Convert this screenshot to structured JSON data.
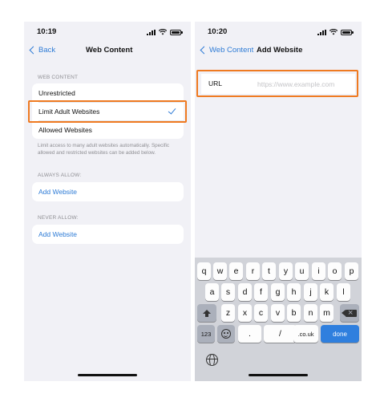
{
  "left": {
    "time": "10:19",
    "back_label": "Back",
    "title": "Web Content",
    "section_web_content": "WEB CONTENT",
    "options": [
      {
        "label": "Unrestricted"
      },
      {
        "label": "Limit Adult Websites",
        "selected": true
      },
      {
        "label": "Allowed Websites"
      }
    ],
    "footnote": "Limit access to many adult websites automatically. Specific allowed and restricted websites can be added below.",
    "section_always_allow": "ALWAYS ALLOW:",
    "always_allow_add": "Add Website",
    "section_never_allow": "NEVER ALLOW:",
    "never_allow_add": "Add Website"
  },
  "right": {
    "time": "10:20",
    "back_label": "Web Content",
    "title": "Add Website",
    "url_label": "URL",
    "url_value": "",
    "url_placeholder": "https://www.example.com",
    "keyboard": {
      "row1": [
        "q",
        "w",
        "e",
        "r",
        "t",
        "y",
        "u",
        "i",
        "o",
        "p"
      ],
      "row2": [
        "a",
        "s",
        "d",
        "f",
        "g",
        "h",
        "j",
        "k",
        "l"
      ],
      "row3": [
        "z",
        "x",
        "c",
        "v",
        "b",
        "n",
        "m"
      ],
      "numbers_key": "123",
      "dot_key": ".",
      "slash_key": "/",
      "dotcom_key": ".co.uk",
      "done_key": "done"
    }
  },
  "colors": {
    "accent": "#2f7cd6",
    "highlight": "#ef7a21",
    "background": "#f1f1f6"
  },
  "icons": [
    "chevron-left-icon",
    "checkmark-icon",
    "shift-icon",
    "backspace-icon",
    "emoji-icon",
    "globe-icon",
    "signal-icon",
    "wifi-icon",
    "battery-icon"
  ]
}
